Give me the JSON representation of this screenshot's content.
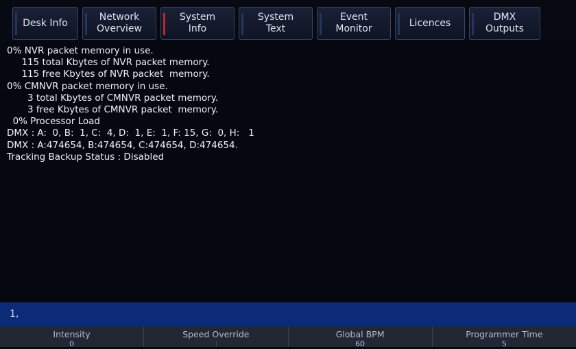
{
  "tabs": [
    {
      "label": "Desk Info",
      "active": false
    },
    {
      "label": "Network\nOverview",
      "active": false
    },
    {
      "label": "System\nInfo",
      "active": true
    },
    {
      "label": "System\nText",
      "active": false
    },
    {
      "label": "Event\nMonitor",
      "active": false
    },
    {
      "label": "Licences",
      "active": false
    },
    {
      "label": "DMX\nOutputs",
      "active": false
    }
  ],
  "output": {
    "lines": [
      "0% NVR packet memory in use.",
      "     115 total Kbytes of NVR packet memory.",
      "     115 free Kbytes of NVR packet  memory.",
      "0% CMNVR packet memory in use.",
      "       3 total Kbytes of CMNVR packet memory.",
      "       3 free Kbytes of CMNVR packet  memory.",
      "  0% Processor Load",
      "DMX : A:  0, B:  1, C:  4, D:  1, E:  1, F: 15, G:  0, H:   1",
      "DMX : A:474654, B:474654, C:474654, D:474654.",
      "Tracking Backup Status : Disabled"
    ]
  },
  "command_line": {
    "text": "1,"
  },
  "encoders": [
    {
      "label": "Intensity",
      "value": "0"
    },
    {
      "label": "Speed Override",
      "value": ""
    },
    {
      "label": "Global BPM",
      "value": "60"
    },
    {
      "label": "Programmer Time",
      "value": "5"
    }
  ],
  "colors": {
    "background": "#060811",
    "command_line_bg": "#0d2a78",
    "active_tab_marker": "#c0242c",
    "encoder_bar_bg": "#222734"
  }
}
